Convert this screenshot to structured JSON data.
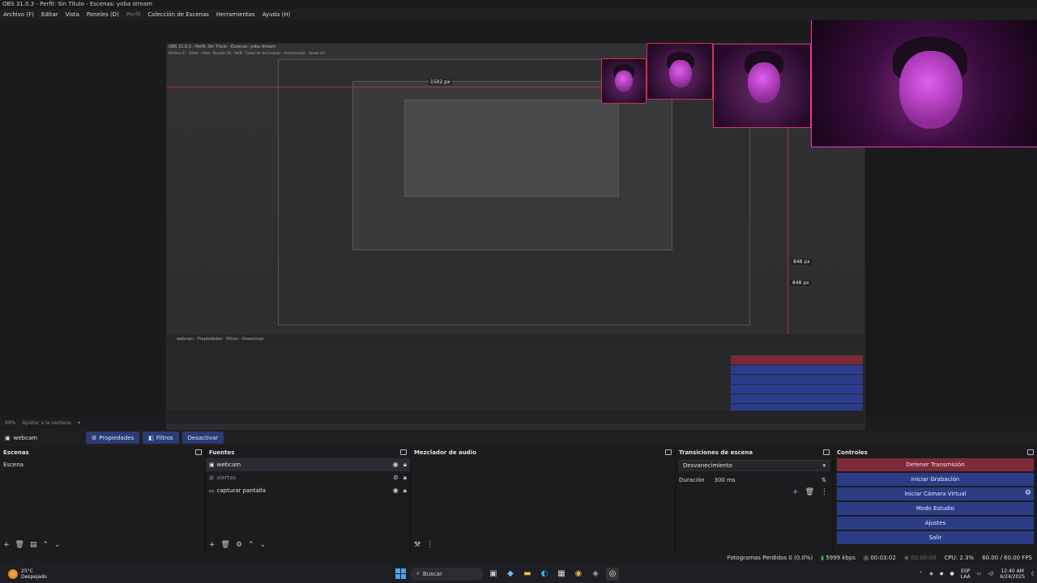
{
  "window": {
    "title": "OBS 31.0.3 - Perfil: Sin Título - Escenas: yoba stream"
  },
  "menu": [
    {
      "label": "Archivo (F)",
      "enabled": true
    },
    {
      "label": "Editar",
      "enabled": true
    },
    {
      "label": "Vista",
      "enabled": true
    },
    {
      "label": "Paneles (D)",
      "enabled": true
    },
    {
      "label": "Perfil",
      "enabled": false
    },
    {
      "label": "Colección de Escenas",
      "enabled": true
    },
    {
      "label": "Herramientas",
      "enabled": true
    },
    {
      "label": "Ayuda (H)",
      "enabled": true
    }
  ],
  "preview": {
    "measure_width": "1502 px",
    "measure_height_a": "848 px",
    "measure_height_b": "848 px"
  },
  "zoom": {
    "percent": "99%",
    "mode": "Ajustar a la ventana"
  },
  "source_toolbar": {
    "source_name": "webcam",
    "properties": "Propiedades",
    "filters": "Filtros",
    "deactivate": "Desactivar"
  },
  "scenes": {
    "title": "Escenas",
    "items": [
      "Escena"
    ]
  },
  "sources": {
    "title": "Fuentes",
    "items": [
      {
        "name": "webcam",
        "icon": "camera-icon",
        "visible": true
      },
      {
        "name": "alertas",
        "icon": "globe-icon",
        "visible": false
      },
      {
        "name": "capturar pantalla",
        "icon": "monitor-icon",
        "visible": true
      }
    ]
  },
  "mixer": {
    "title": "Mezclador de audio"
  },
  "transitions": {
    "title": "Transiciones de escena",
    "selected": "Desvanecimiento",
    "duration_label": "Duración",
    "duration_value": "300 ms"
  },
  "controls": {
    "title": "Controles",
    "buttons": [
      {
        "label": "Detener Transmisión",
        "style": "red"
      },
      {
        "label": "Iniciar Grabación",
        "style": "blue"
      },
      {
        "label": "Iniciar Cámara Virtual",
        "style": "blue"
      },
      {
        "label": "Modo Estudio",
        "style": "blue"
      },
      {
        "label": "Ajustes",
        "style": "blue"
      },
      {
        "label": "Salir",
        "style": "blue"
      }
    ]
  },
  "status": {
    "dropped_frames": "Fotogramas Perdidos 0 (0.0%)",
    "bitrate": "5999 kbps",
    "stream_time": "00:03:02",
    "rec_time": "00:00:00",
    "cpu": "CPU: 2.3%",
    "fps": "60.00 / 60.00 FPS"
  },
  "taskbar": {
    "temperature": "25°C",
    "weather": "Despejado",
    "search_placeholder": "Buscar",
    "lang_top": "ESP",
    "lang_bottom": "LAA",
    "time": "12:40 AM",
    "date": "6/24/2025"
  },
  "colors": {
    "accent_blue": "#2c3d86",
    "stream_red": "#7f2a39",
    "overlay_line": "#b3303a"
  }
}
